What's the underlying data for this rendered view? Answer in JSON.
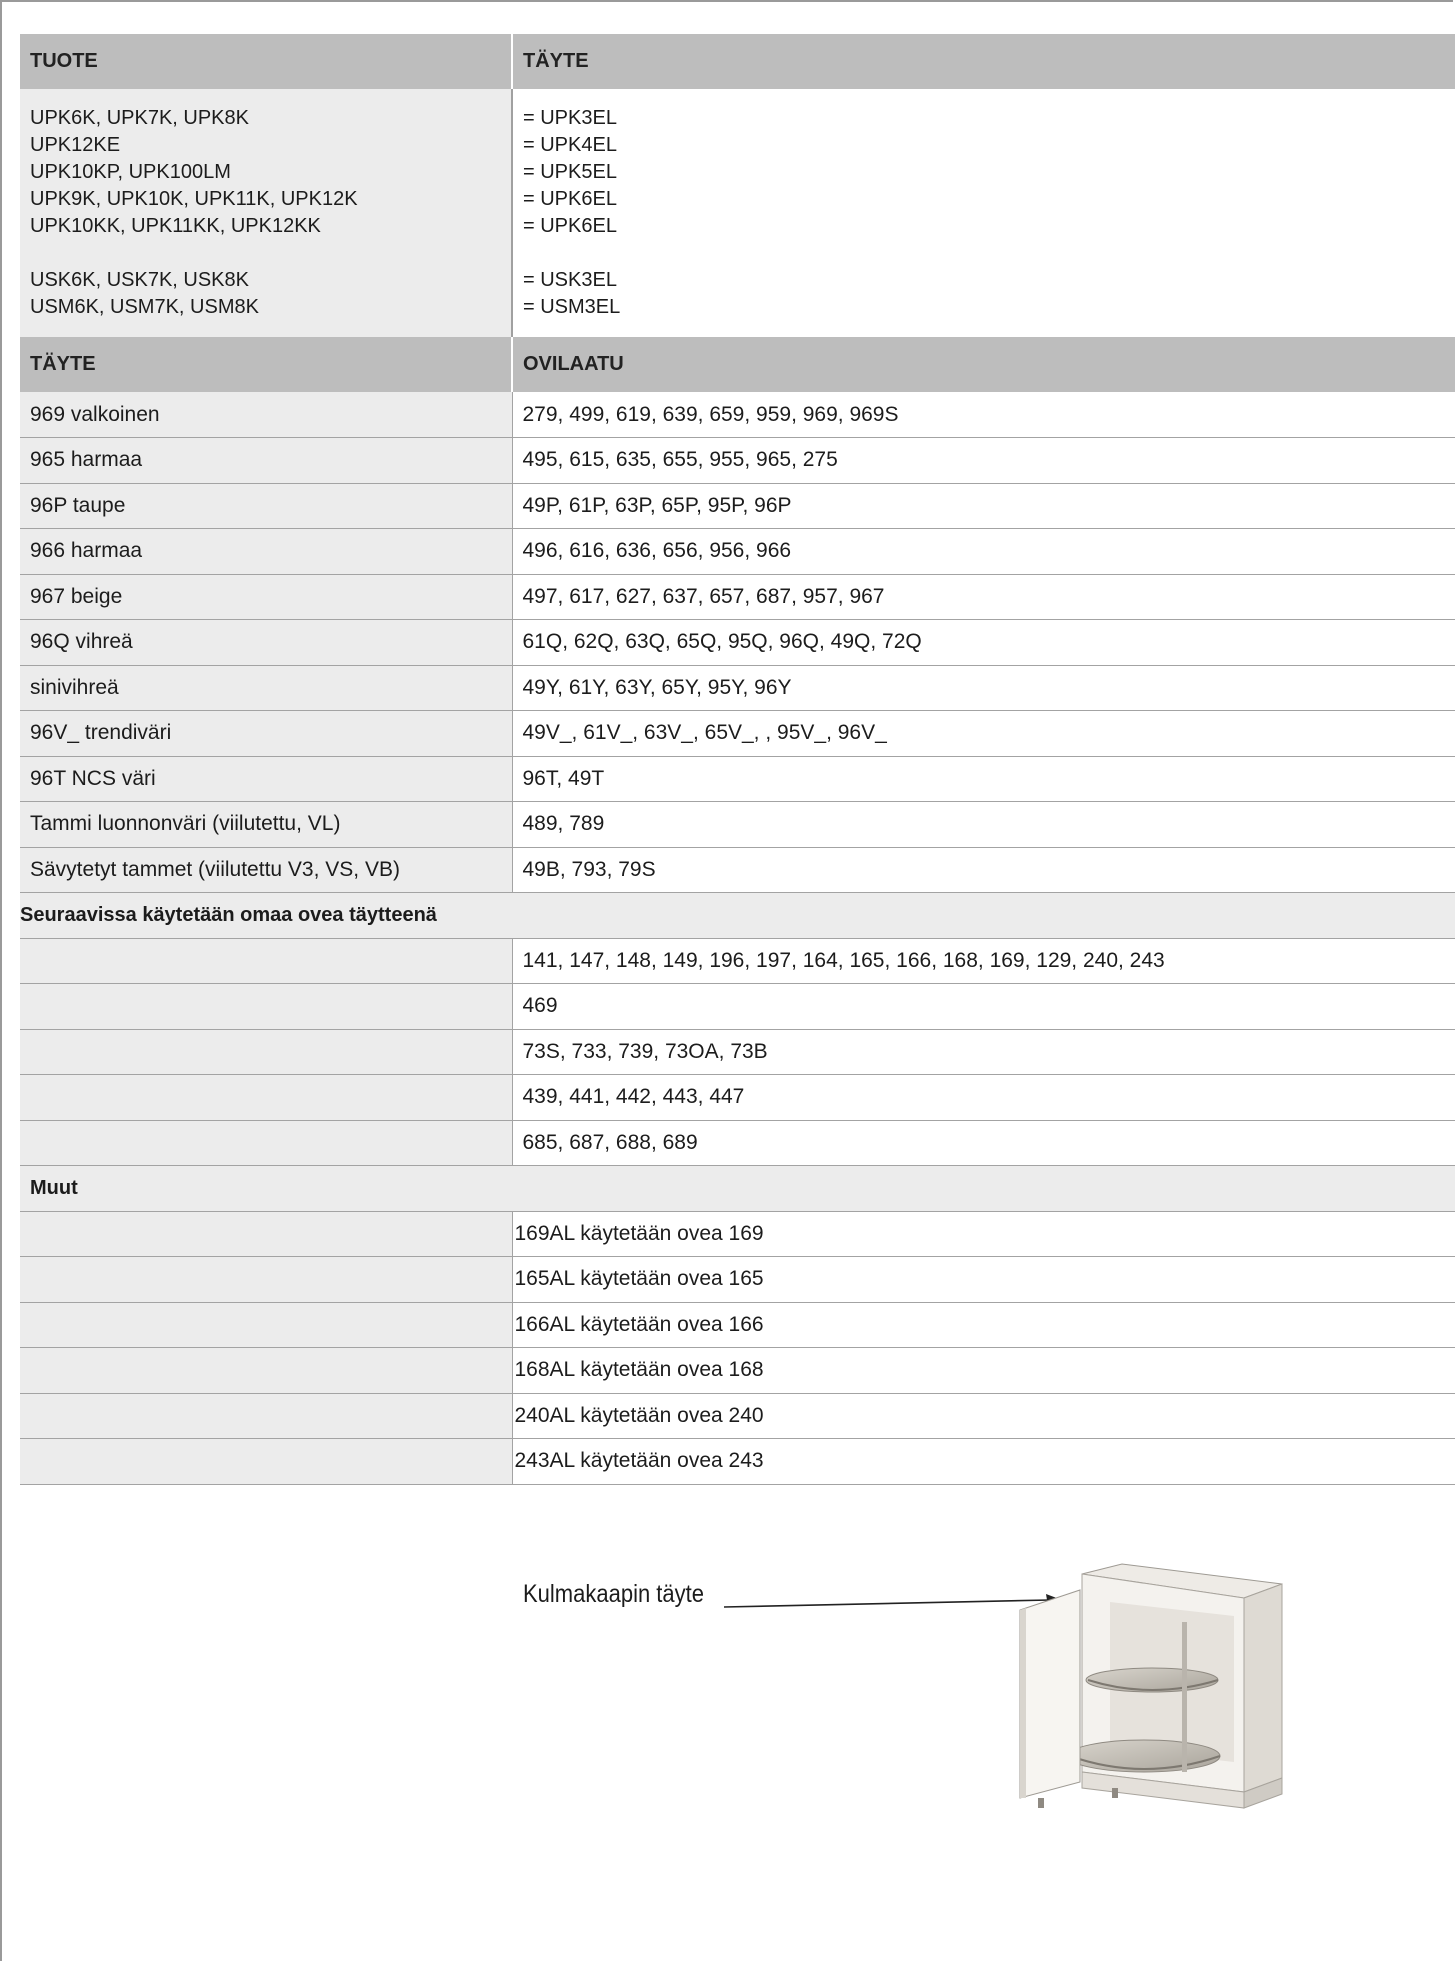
{
  "mapping_header": {
    "col1": "TUOTE",
    "col2": "TÄYTE"
  },
  "mapping_rows": {
    "products": [
      "UPK6K, UPK7K, UPK8K",
      "UPK12KE",
      "UPK10KP, UPK100LM",
      "UPK9K, UPK10K, UPK11K, UPK12K",
      "UPK10KK, UPK11KK, UPK12KK",
      "",
      "USK6K, USK7K, USK8K",
      "USM6K, USM7K, USM8K"
    ],
    "fills": [
      "= UPK3EL",
      "= UPK4EL",
      "= UPK5EL",
      "= UPK6EL",
      "= UPK6EL",
      "",
      "= USK3EL",
      "= USM3EL"
    ]
  },
  "color_header": {
    "col1": "TÄYTE",
    "col2": "OVILAATU"
  },
  "color_rows": [
    {
      "fill": "969 valkoinen",
      "doors": "279, 499, 619, 639, 659, 959, 969, 969S"
    },
    {
      "fill": "965 harmaa",
      "doors": "495, 615, 635, 655, 955, 965, 275"
    },
    {
      "fill": "96P taupe",
      "doors": "49P, 61P, 63P, 65P, 95P, 96P"
    },
    {
      "fill": "966 harmaa",
      "doors": "496, 616, 636, 656, 956, 966"
    },
    {
      "fill": "967 beige",
      "doors": "497, 617, 627, 637, 657, 687, 957, 967"
    },
    {
      "fill": "96Q vihreä",
      "doors": "61Q, 62Q, 63Q, 65Q, 95Q, 96Q, 49Q, 72Q"
    },
    {
      "fill": "sinivihreä",
      "doors": "49Y, 61Y, 63Y, 65Y, 95Y, 96Y"
    },
    {
      "fill": "96V_ trendiväri",
      "doors": "49V_, 61V_, 63V_, 65V_, , 95V_, 96V_"
    },
    {
      "fill": "96T NCS väri",
      "doors": "96T, 49T"
    },
    {
      "fill": "Tammi luonnonväri (viilutettu, VL)",
      "doors": "489, 789"
    },
    {
      "fill": "Sävytetyt  tammet (viilutettu V3, VS, VB)",
      "doors": "49B, 793, 79S"
    }
  ],
  "own_door_section": {
    "title": "Seuraavissa käytetään omaa ovea täytteenä",
    "rows": [
      "141, 147, 148, 149, 196, 197, 164, 165, 166, 168, 169, 129, 240, 243",
      "469",
      "73S, 733, 739, 73OA, 73B",
      "439, 441, 442, 443, 447",
      "685, 687, 688, 689"
    ]
  },
  "other_section": {
    "title": "Muut",
    "rows": [
      "169AL käytetään ovea 169",
      "165AL käytetään ovea 165",
      "166AL käytetään ovea 166",
      "168AL käytetään ovea 168",
      "240AL käytetään ovea 240",
      "243AL käytetään ovea 243"
    ]
  },
  "illustration": {
    "label": "Kulmakaapin täyte",
    "icon": "corner-cabinet-carousel-illustration"
  }
}
